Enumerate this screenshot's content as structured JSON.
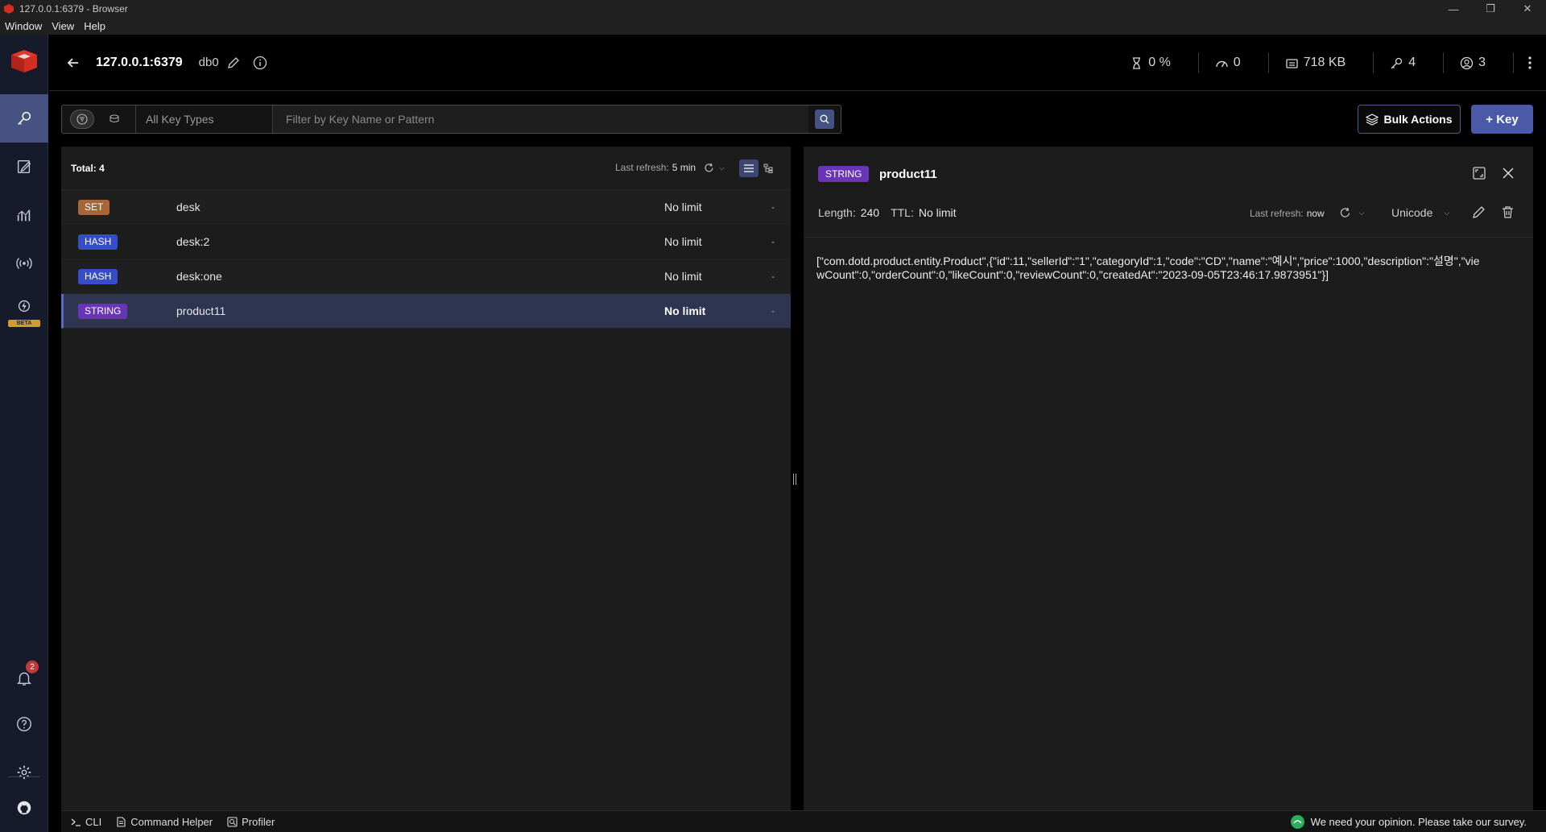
{
  "window": {
    "title": "127.0.0.1:6379 - Browser",
    "minimize": "—",
    "maximize": "❐",
    "close": "✕"
  },
  "menu": [
    "Window",
    "View",
    "Help"
  ],
  "header": {
    "host": "127.0.0.1:6379",
    "db": "db0",
    "stats": {
      "cpu": "0 %",
      "ops": "0",
      "memory": "718 KB",
      "keys": "4",
      "clients": "3"
    }
  },
  "sidebar": {
    "notifications_count": "2",
    "beta_label": "BETA"
  },
  "toolbar": {
    "key_type_placeholder": "All Key Types",
    "search_placeholder": "Filter by Key Name or Pattern",
    "bulk_actions_label": "Bulk Actions",
    "add_key_label": "+ Key"
  },
  "keylist": {
    "total_label": "Total: 4",
    "last_refresh_label": "Last refresh:",
    "last_refresh_value": "5 min",
    "rows": [
      {
        "type": "SET",
        "name": "desk",
        "ttl": "No limit",
        "size": "-"
      },
      {
        "type": "HASH",
        "name": "desk:2",
        "ttl": "No limit",
        "size": "-"
      },
      {
        "type": "HASH",
        "name": "desk:one",
        "ttl": "No limit",
        "size": "-"
      },
      {
        "type": "STRING",
        "name": "product11",
        "ttl": "No limit",
        "size": "-"
      }
    ]
  },
  "details": {
    "type": "STRING",
    "name": "product11",
    "length_label": "Length:",
    "length_value": "240",
    "ttl_label": "TTL:",
    "ttl_value": "No limit",
    "last_refresh_label": "Last refresh:",
    "last_refresh_value": "now",
    "format": "Unicode",
    "value": "[\"com.dotd.product.entity.Product\",{\"id\":11,\"sellerId\":\"1\",\"categoryId\":1,\"code\":\"CD\",\"name\":\"예시\",\"price\":1000,\"description\":\"설명\",\"viewCount\":0,\"orderCount\":0,\"likeCount\":0,\"reviewCount\":0,\"createdAt\":\"2023-09-05T23:46:17.9873951\"}]"
  },
  "bottombar": {
    "cli": "CLI",
    "command_helper": "Command Helper",
    "profiler": "Profiler",
    "survey": "We need your opinion. Please take our survey."
  },
  "colors": {
    "accent": "#465282",
    "set": "#a8653a",
    "hash": "#364cc8",
    "string": "#6935b8"
  }
}
